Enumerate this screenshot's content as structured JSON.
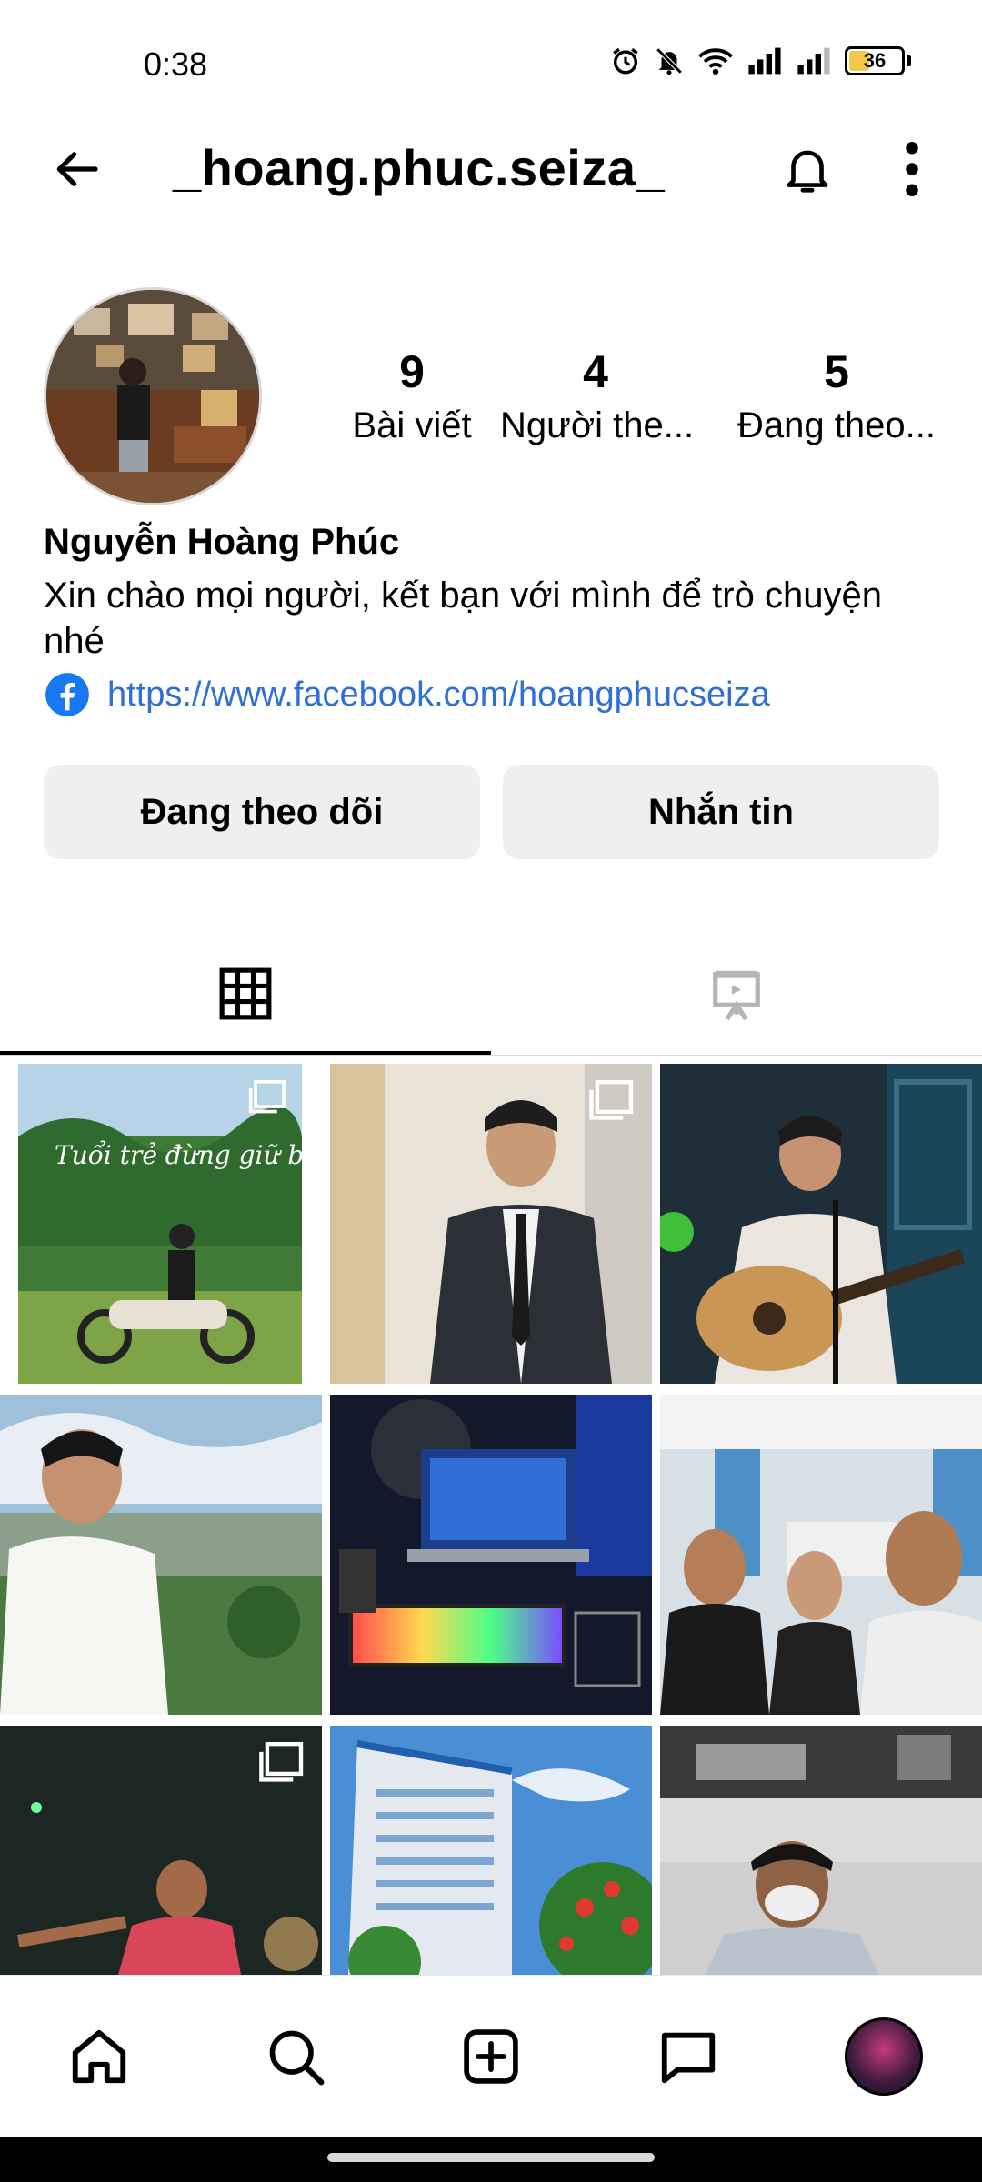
{
  "status_bar": {
    "time": "0:38",
    "battery_level": "36",
    "icons": [
      "alarm-icon",
      "mute-icon",
      "wifi-icon",
      "signal-icon",
      "signal-icon",
      "battery-icon"
    ]
  },
  "header": {
    "username": "_hoang.phuc.seiza_",
    "icons": [
      "back-arrow-icon",
      "bell-icon",
      "more-vertical-icon"
    ]
  },
  "profile": {
    "stats": [
      {
        "value": "9",
        "label": "Bài viết"
      },
      {
        "value": "4",
        "label": "Người the..."
      },
      {
        "value": "5",
        "label": "Đang theo..."
      }
    ],
    "full_name": "Nguyễn Hoàng Phúc",
    "bio": "Xin chào mọi người, kết bạn với mình để trò chuyện nhé",
    "link": "https://www.facebook.com/hoangphucseiza",
    "link_icon": "facebook-icon"
  },
  "actions": {
    "following_label": "Đang theo dõi",
    "message_label": "Nhắn tin"
  },
  "tabs": [
    {
      "icon": "grid-icon",
      "selected": true
    },
    {
      "icon": "reels-icon",
      "selected": false
    }
  ],
  "grid": {
    "post_overlay_text": "Tuổi trẻ đừng giữ bao nhiêu?",
    "posts": [
      {
        "name": "post-motorbike-jungle",
        "multi": true
      },
      {
        "name": "post-suit-portrait",
        "multi": true
      },
      {
        "name": "post-guitar-singing",
        "multi": false
      },
      {
        "name": "post-white-shirt-city-view",
        "multi": false
      },
      {
        "name": "post-laptop-setup",
        "multi": false
      },
      {
        "name": "post-group-selfie",
        "multi": false
      },
      {
        "name": "post-night-basketball",
        "multi": true
      },
      {
        "name": "post-hospital-building",
        "multi": false
      },
      {
        "name": "post-masked-portrait",
        "multi": false
      }
    ]
  },
  "bottom_nav": {
    "items": [
      "home-icon",
      "search-icon",
      "new-post-icon",
      "messages-icon",
      "profile-avatar"
    ]
  },
  "colors": {
    "link": "#2f6fd6",
    "button_bg": "#efefef",
    "facebook_blue": "#1877f2",
    "battery_fill": "#f2c94c"
  }
}
